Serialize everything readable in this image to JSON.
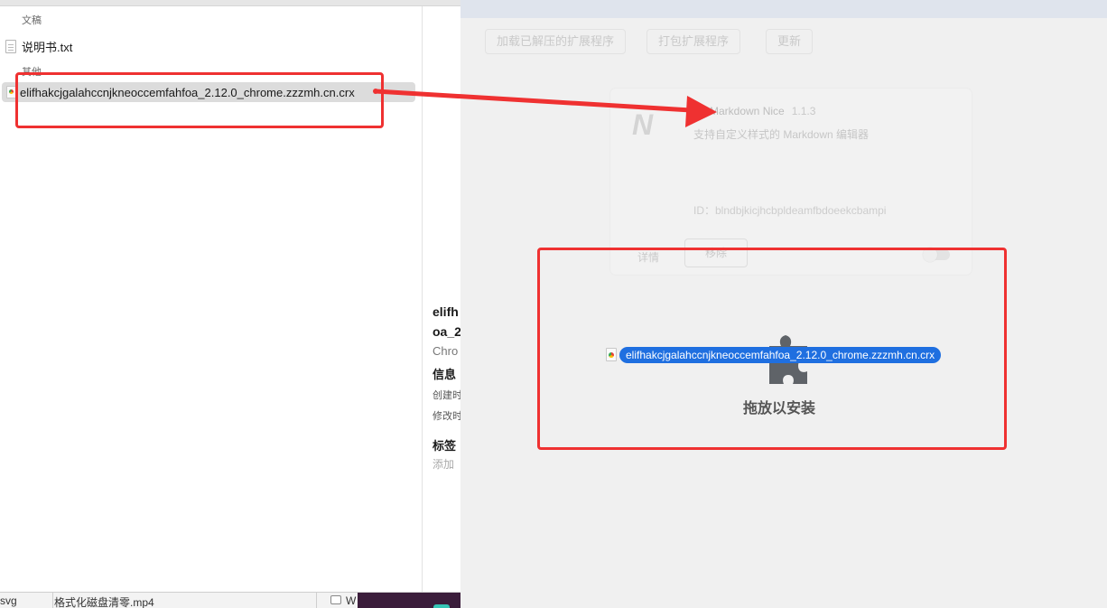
{
  "finder": {
    "section_documents": "文稿",
    "section_other": "其他",
    "files": [
      {
        "name": "说明书.txt",
        "icon": "text-file-icon"
      },
      {
        "name": "elifhakcjgalahccnjkneoccemfahfoa_2.12.0_chrome.zzzmh.cn.crx",
        "icon": "crx-file-icon"
      }
    ],
    "preview": {
      "title_line1": "elifh",
      "title_line2": "oa_2",
      "kind": "Chro",
      "info_header": "信息",
      "created": "创建时",
      "modified": "修改时",
      "tags_header": "标签",
      "add_tag": "添加"
    },
    "bottom": {
      "left_text": "svg",
      "middle_text": "格式化磁盘清零.mp4",
      "right_text": "W"
    }
  },
  "chrome": {
    "buttons": {
      "load_unpacked": "加载已解压的扩展程序",
      "pack": "打包扩展程序",
      "update": "更新"
    },
    "extension": {
      "logo": "N",
      "name": "Markdown Nice",
      "version": "1.1.3",
      "description": "支持自定义样式的 Markdown 编辑器",
      "id": "ID：blndbjkicjhcbpldeamfbdoeekcbampi",
      "details": "详情",
      "remove": "移除"
    },
    "drop_label": "拖放以安装"
  },
  "drag": {
    "filename": "elifhakcjgalahccnjkneoccemfahfoa_2.12.0_chrome.zzzmh.cn.crx"
  },
  "colors": {
    "annotation": "#ef3131",
    "selection_blue": "#1f6fe0",
    "finder_selection": "#dcdcdc",
    "chrome_background": "#f0f0f0"
  }
}
